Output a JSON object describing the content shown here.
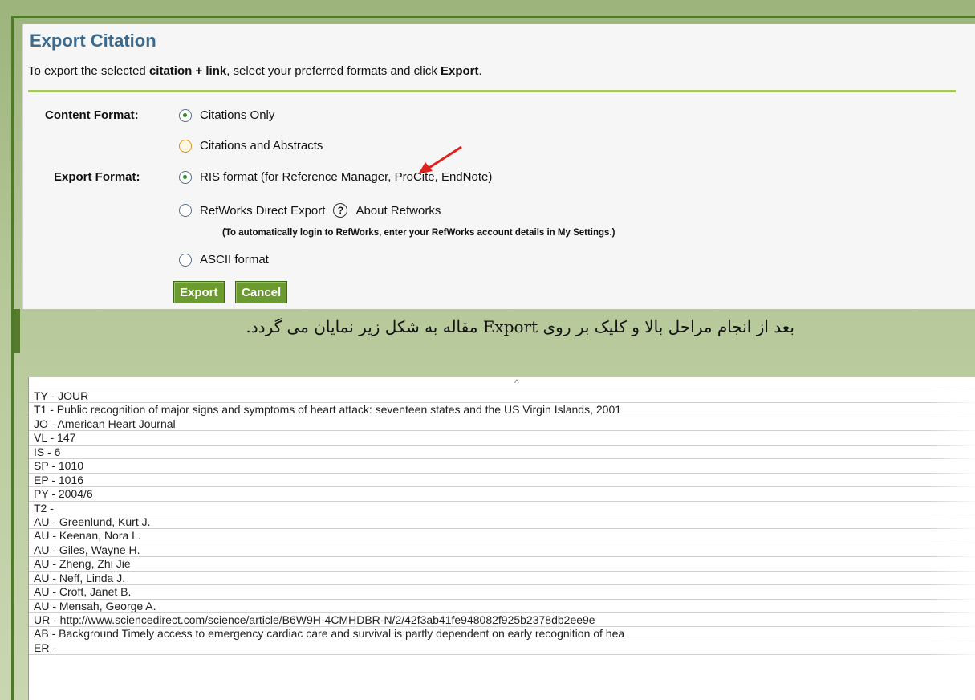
{
  "export_panel": {
    "title": "Export Citation",
    "intro": {
      "before": "To export the selected ",
      "bold1": "citation + link",
      "middle": ", select your preferred formats and click ",
      "bold2": "Export",
      "after": "."
    },
    "content_format": {
      "label": "Content Format:",
      "options": [
        "Citations Only",
        "Citations and Abstracts"
      ],
      "selected": "Citations Only"
    },
    "export_format": {
      "label": "Export Format:",
      "options": [
        "RIS format (for Reference Manager, ProCite, EndNote)",
        "RefWorks Direct Export",
        "ASCII format"
      ],
      "selected": "RIS format (for Reference Manager, ProCite, EndNote)",
      "about_link": "About Refworks",
      "refworks_note": "(To automatically login to RefWorks, enter your RefWorks account details in My Settings.)"
    },
    "buttons": {
      "export": "Export",
      "cancel": "Cancel"
    },
    "colors": {
      "title": "#3b6a8e",
      "button": "#6b9a2e",
      "rule": "#a9c760",
      "arrow": "#e0201c"
    }
  },
  "caption": "بعد از انجام مراحل بالا و کلیک بر روی Export مقاله به شکل زیر نمایان می گردد.",
  "ris_output": {
    "lines": [
      "TY  - JOUR",
      "T1  - Public recognition of major signs and symptoms of heart attack: seventeen states and the US Virgin Islands, 2001",
      "JO  - American Heart Journal",
      "VL  - 147",
      "IS  - 6",
      "SP  - 1010",
      "EP  - 1016",
      "PY  - 2004/6",
      "T2  -",
      "AU  - Greenlund, Kurt J.",
      "AU  - Keenan, Nora L.",
      "AU  - Giles, Wayne H.",
      "AU  - Zheng, Zhi Jie",
      "AU  - Neff, Linda J.",
      "AU  - Croft, Janet B.",
      "AU  - Mensah, George A.",
      "UR  - http://www.sciencedirect.com/science/article/B6W9H-4CMHDBR-N/2/42f3ab41fe948082f925b2378db2ee9e",
      "AB  - Background Timely access to emergency cardiac care and survival is partly dependent on early recognition of hea",
      "ER  -"
    ]
  }
}
